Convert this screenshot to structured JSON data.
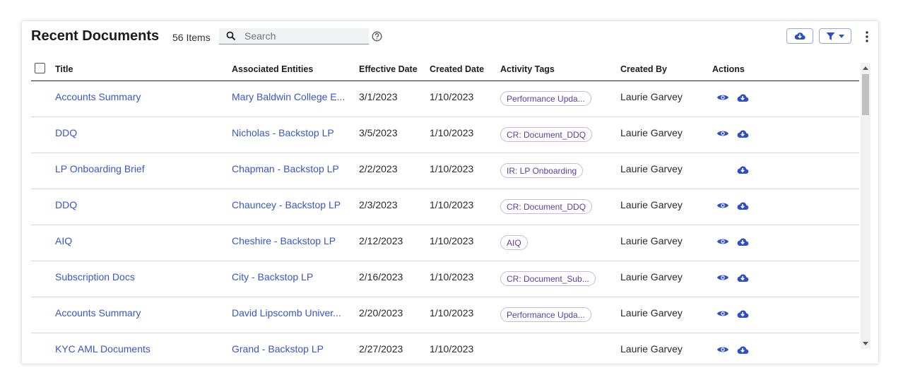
{
  "header": {
    "title": "Recent Documents",
    "count": "56 Items",
    "search_placeholder": "Search",
    "search_value": "",
    "icons": [
      "search-icon",
      "help-icon",
      "cloud-download-icon",
      "filter-icon",
      "chevron-down-icon",
      "more-vert-icon"
    ]
  },
  "columns": {
    "title": "Title",
    "entities": "Associated Entities",
    "effective": "Effective Date",
    "created": "Created Date",
    "tags": "Activity Tags",
    "created_by": "Created By",
    "actions": "Actions"
  },
  "rows": [
    {
      "title": "Accounts Summary",
      "entity": "Mary Baldwin College E...",
      "effective": "3/1/2023",
      "created": "1/10/2023",
      "tag": "Performance Upda...",
      "created_by": "Laurie Garvey",
      "view": true
    },
    {
      "title": "DDQ",
      "entity": "Nicholas - Backstop LP",
      "effective": "3/5/2023",
      "created": "1/10/2023",
      "tag": "CR: Document_DDQ",
      "created_by": "Laurie Garvey",
      "view": true
    },
    {
      "title": "LP Onboarding Brief",
      "entity": "Chapman - Backstop LP",
      "effective": "2/2/2023",
      "created": "1/10/2023",
      "tag": "IR: LP Onboarding",
      "created_by": "Laurie Garvey",
      "view": false
    },
    {
      "title": "DDQ",
      "entity": "Chauncey - Backstop LP",
      "effective": "2/3/2023",
      "created": "1/10/2023",
      "tag": "CR: Document_DDQ",
      "created_by": "Laurie Garvey",
      "view": true
    },
    {
      "title": "AIQ",
      "entity": "Cheshire - Backstop LP",
      "effective": "2/12/2023",
      "created": "1/10/2023",
      "tag": "AIQ",
      "created_by": "Laurie Garvey",
      "view": true
    },
    {
      "title": "Subscription Docs",
      "entity": "City - Backstop LP",
      "effective": "2/16/2023",
      "created": "1/10/2023",
      "tag": "CR: Document_Sub...",
      "created_by": "Laurie Garvey",
      "view": true
    },
    {
      "title": "Accounts Summary",
      "entity": "David Lipscomb Univer...",
      "effective": "2/20/2023",
      "created": "1/10/2023",
      "tag": "Performance Upda...",
      "created_by": "Laurie Garvey",
      "view": true
    },
    {
      "title": "KYC AML Documents",
      "entity": "Grand - Backstop LP",
      "effective": "2/27/2023",
      "created": "1/10/2023",
      "tag": "",
      "created_by": "Laurie Garvey",
      "view": true
    }
  ],
  "colors": {
    "link": "#3a55c9",
    "tag_border": "#c7b8e6",
    "tag_text": "#5a3fa3",
    "icon_blue": "#2f4fc4"
  }
}
